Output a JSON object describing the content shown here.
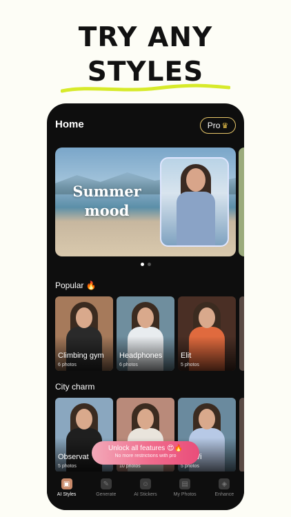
{
  "headline": {
    "line1": "TRY ANY",
    "line2": "STYLES"
  },
  "colors": {
    "accent_underline": "#d7ea2a",
    "pro_border": "#e9c86a",
    "unlock_gradient": "#f06b8c"
  },
  "header": {
    "title": "Home",
    "pro_label": "Pro",
    "pro_icon": "crown-icon"
  },
  "banner": {
    "text": "Summer mood",
    "line1": "Summer",
    "line2": "mood",
    "active_slide": 1,
    "total_slides": 2
  },
  "sections": [
    {
      "title": "Popular 🔥",
      "cards": [
        {
          "title": "Climbing gym",
          "subtitle": "6 photos",
          "bg": "#a67a5b",
          "body": "#2a2a2a"
        },
        {
          "title": "Headphones",
          "subtitle": "6 photos",
          "bg": "#6f8e9e",
          "body": "#e8ecef"
        },
        {
          "title": "Elit",
          "subtitle": "5 photos",
          "bg": "#4a2f25",
          "body": "#e06a3e"
        }
      ]
    },
    {
      "title": "City charm",
      "cards": [
        {
          "title": "Observat",
          "subtitle": "5 photos",
          "bg": "#8aa7bf",
          "body": "#1f1f1f"
        },
        {
          "title": "",
          "subtitle": "10 photos",
          "bg": "#b98a7a",
          "body": "#e9e4dc"
        },
        {
          "title": "ing Wi",
          "subtitle": "5 photos",
          "bg": "#6a8a9e",
          "body": "#b7c9e6"
        }
      ]
    }
  ],
  "unlock": {
    "title": "Unlock all features 😍🔥",
    "subtitle": "No more restrictions with pro"
  },
  "tabs": [
    {
      "label": "AI Styles",
      "icon": "ai-styles-icon",
      "active": true
    },
    {
      "label": "Generate",
      "icon": "generate-icon",
      "active": false
    },
    {
      "label": "AI Stickers",
      "icon": "stickers-icon",
      "active": false
    },
    {
      "label": "My Photos",
      "icon": "photos-icon",
      "active": false
    },
    {
      "label": "Enhance",
      "icon": "enhance-icon",
      "active": false
    }
  ]
}
